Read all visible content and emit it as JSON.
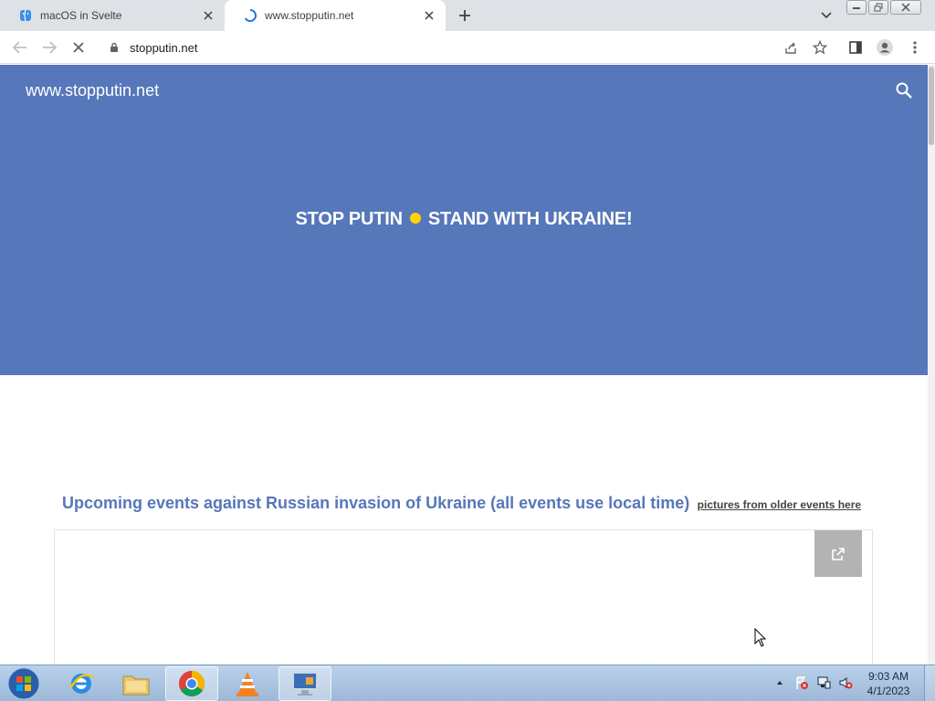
{
  "browser": {
    "tabs": [
      {
        "title": "macOS in Svelte",
        "favicon": "finder-face-icon"
      },
      {
        "title": "www.stopputin.net",
        "favicon": "loading-spinner-icon"
      }
    ],
    "address": "stopputin.net"
  },
  "page": {
    "site_title": "www.stopputin.net",
    "headline_left": "STOP PUTIN",
    "headline_right": "STAND WITH UKRAINE!",
    "events_title": "Upcoming events against Russian invasion of Ukraine (all events use local time)",
    "events_link": "pictures from older events here",
    "colors": {
      "hero": "#5677b9",
      "dot": "#ffd500",
      "embed_button": "#b3b3b3"
    }
  },
  "taskbar": {
    "apps": [
      "internet-explorer",
      "file-explorer",
      "chrome",
      "vlc",
      "remote-desktop"
    ],
    "time": "9:03 AM",
    "date": "4/1/2023"
  }
}
